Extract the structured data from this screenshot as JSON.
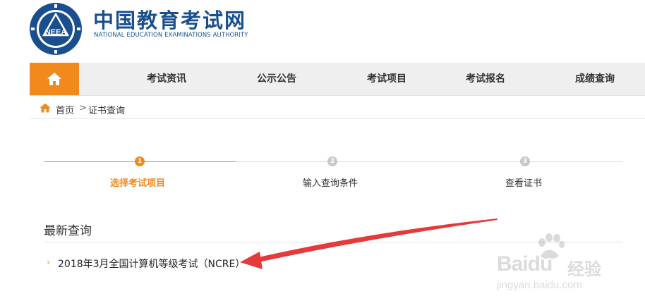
{
  "header": {
    "logo_seal_text": "NEEA",
    "title_cn": "中国教育考试网",
    "title_en": "NATIONAL EDUCATION EXAMINATIONS AUTHORITY"
  },
  "nav": {
    "home_icon": "home-icon",
    "items": [
      "考试资讯",
      "公示公告",
      "考试项目",
      "考试报名",
      "成绩查询"
    ]
  },
  "breadcrumb": {
    "home": "首页",
    "separator": ">",
    "current": "证书查询"
  },
  "steps": [
    {
      "number": "1",
      "label": "选择考试项目",
      "active": true
    },
    {
      "number": "2",
      "label": "输入查询条件",
      "active": false
    },
    {
      "number": "3",
      "label": "查看证书",
      "active": false
    }
  ],
  "latest": {
    "title": "最新查询",
    "items": [
      "2018年3月全国计算机等级考试（NCRE）"
    ]
  },
  "watermark": {
    "brand": "Baidu",
    "cn": "经验",
    "url": "jingyan.baidu.com"
  },
  "colors": {
    "accent": "#f28a1b",
    "brand_blue": "#1a4f8f",
    "nav_bg": "#efefef",
    "step_inactive": "#c8c8c8",
    "annotation_red": "#e43a3a"
  }
}
